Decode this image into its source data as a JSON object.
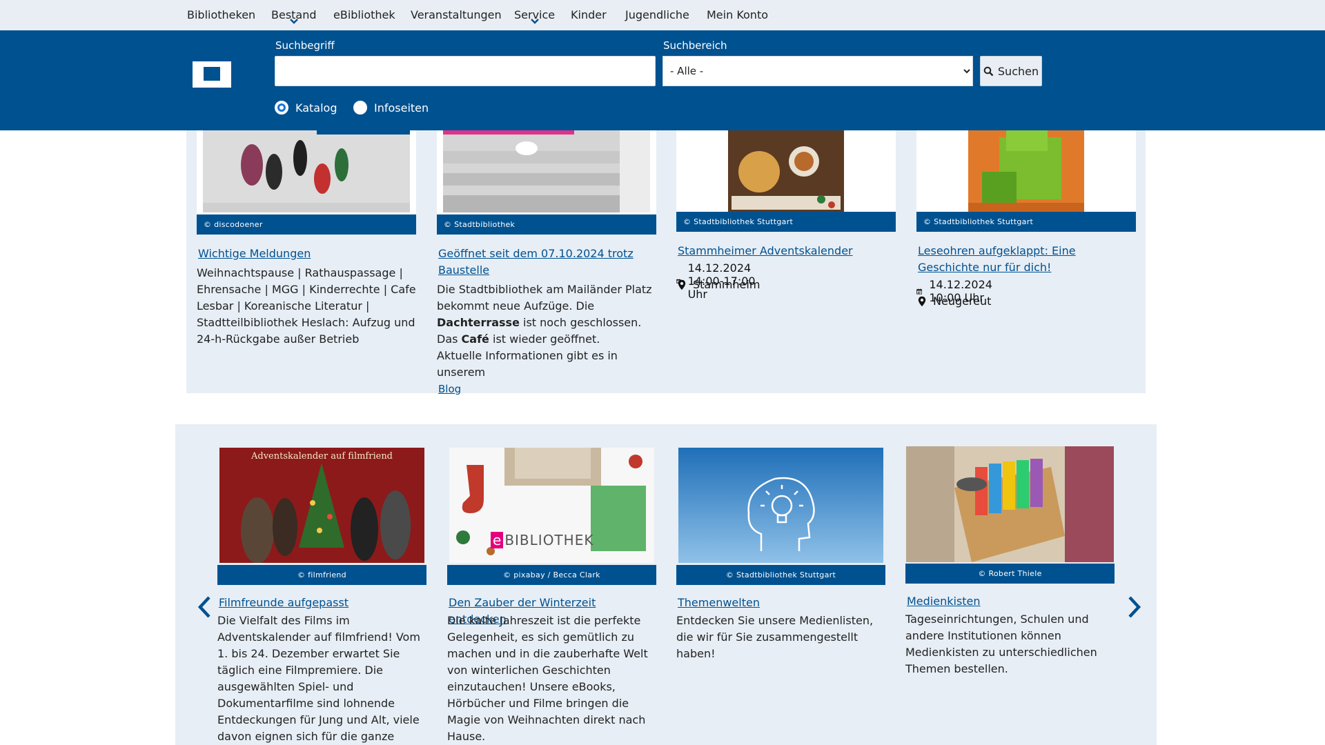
{
  "nav": {
    "items": [
      {
        "label": "Bibliotheken",
        "has_submenu": false
      },
      {
        "label": "Bestand",
        "has_submenu": true
      },
      {
        "label": "eBibliothek",
        "has_submenu": false
      },
      {
        "label": "Veranstaltungen",
        "has_submenu": false
      },
      {
        "label": "Service",
        "has_submenu": true
      },
      {
        "label": "Kinder",
        "has_submenu": false
      },
      {
        "label": "Jugendliche",
        "has_submenu": false
      },
      {
        "label": "Mein Konto",
        "has_submenu": false
      }
    ]
  },
  "search": {
    "term_label": "Suchbegriff",
    "term_value": "",
    "scope_label": "Suchbereich",
    "scope_selected": "- Alle -",
    "button_label": "Suchen",
    "radio_catalog": "Katalog",
    "radio_info": "Infoseiten",
    "selected_radio": "Katalog"
  },
  "news": [
    {
      "credit": "© discodoener",
      "title": "Wichtige Meldungen",
      "body": "Weihnachtspause | Rathauspassage | Ehrensache | MGG | Kinderrechte | Cafe Lesbar | Koreanische Literatur | Stadtteilbibliothek Heslach: Aufzug und 24-h-Rückgabe außer Betrieb"
    },
    {
      "credit": "© Stadtbibliothek",
      "title": "Geöffnet seit dem 07.10.2024 trotz Baustelle",
      "body_p1_a": "Die Stadtbibliothek am Mailänder Platz bekommt neue Aufzüge. Die ",
      "body_p1_b": "Dachterrasse",
      "body_p1_c": " ist noch geschlossen. Das ",
      "body_p1_d": "Café",
      "body_p1_e": " ist wieder geöffnet.",
      "body_p2": "Aktuelle Informationen gibt es in unserem",
      "link": "Blog"
    },
    {
      "credit": "© Stadtbibliothek Stuttgart",
      "title": "Stammheimer Adventskalender",
      "date": "14.12.2024 14:00-17:00 Uhr",
      "place": "Stammheim"
    },
    {
      "credit": "© Stadtbibliothek Stuttgart",
      "title": "Leseohren aufgeklappt: Eine Geschichte nur für dich!",
      "date": "14.12.2024 10:00 Uhr",
      "place": "Neugereut"
    }
  ],
  "carousel": {
    "items": [
      {
        "image_caption": "Adventskalender auf filmfriend",
        "credit": "© filmfriend",
        "title": "Filmfreunde aufgepasst",
        "body": "Die Vielfalt des Films im Adventskalender auf filmfriend! Vom 1. bis 24. Dezember erwartet Sie täglich eine Filmpremiere. Die ausgewählten Spiel- und Dokumentarfilme sind lohnende Entdeckungen für Jung und Alt, viele davon eignen sich für die ganze Familie."
      },
      {
        "image_caption_e": "e",
        "image_caption": "BIBLIOTHEK",
        "credit": "© pixabay / Becca Clark",
        "title": "Den Zauber der Winterzeit entdecken",
        "body": "Die kalte Jahreszeit ist die perfekte Gelegenheit, es sich gemütlich zu machen und in die zauberhafte Welt von winterlichen Geschichten einzutauchen! Unsere eBooks, Hörbücher und Filme bringen die Magie von Weihnachten direkt nach Hause."
      },
      {
        "credit": "© Stadtbibliothek Stuttgart",
        "title": "Themenwelten",
        "body": "Entdecken Sie unsere Medienlisten, die wir für Sie zusammengestellt haben!"
      },
      {
        "credit": "© Robert Thiele",
        "title": "Medienkisten",
        "body": "Tageseinrichtungen, Schulen und andere Institutionen können Medienkisten zu unterschiedlichen Themen bestellen."
      }
    ]
  },
  "colors": {
    "brand_blue": "#005190",
    "panel_bg": "#e7eef5",
    "nav_bg": "#e8eef4"
  }
}
